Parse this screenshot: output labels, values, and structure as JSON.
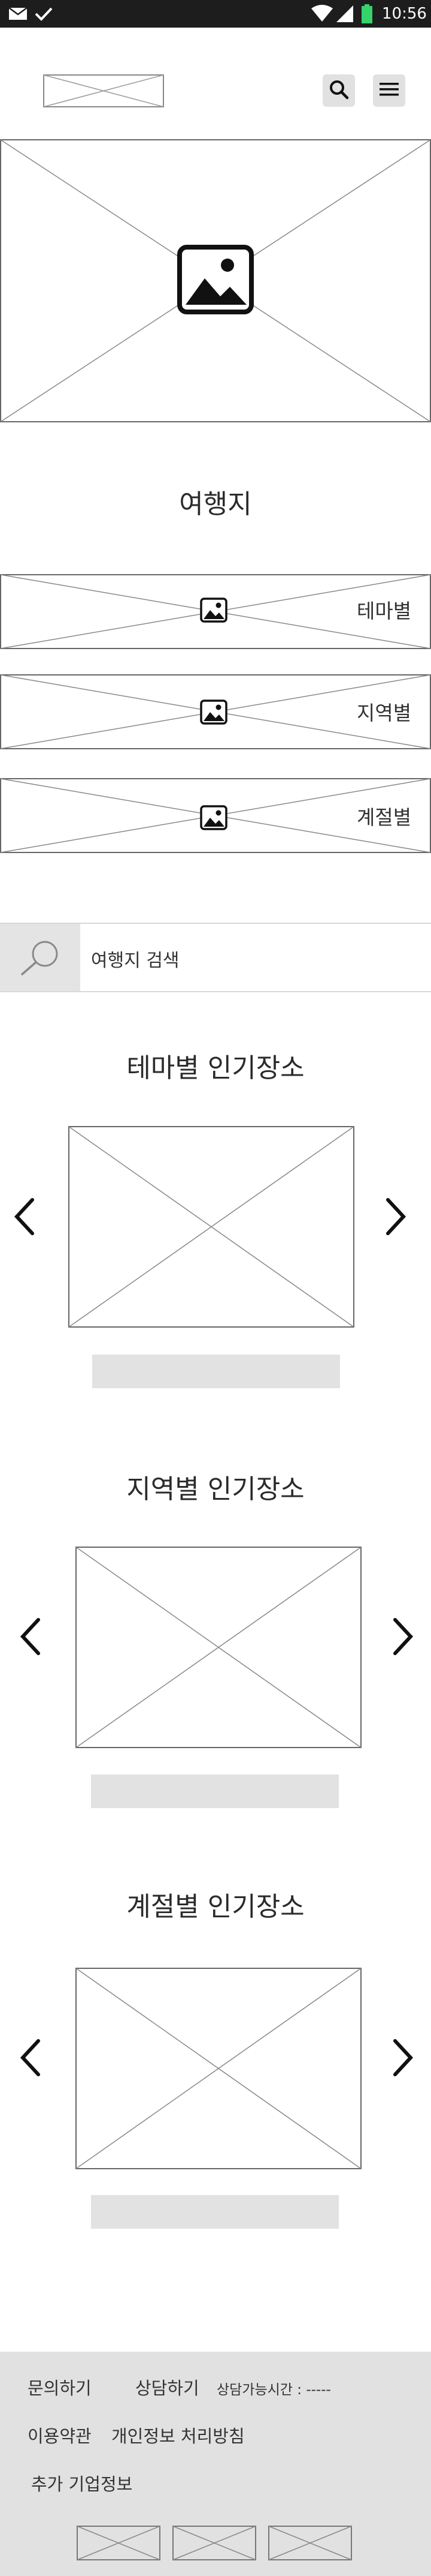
{
  "status_bar": {
    "time": "10:56",
    "left_icons": [
      "mail-icon",
      "check-icon"
    ],
    "right_icons": [
      "wifi-icon",
      "signal-icon",
      "battery-icon"
    ],
    "battery_color": "#36d36a"
  },
  "header": {
    "logo_icon": "logo-placeholder",
    "search_icon": "search-icon",
    "menu_icon": "hamburger-menu-icon"
  },
  "sections": {
    "destinations_title": "여행지",
    "categories": [
      {
        "label": "테마별"
      },
      {
        "label": "지역별"
      },
      {
        "label": "계절별"
      }
    ],
    "search_placeholder": "여행지 검색",
    "carousels": [
      {
        "title": "테마별 인기장소"
      },
      {
        "title": "지역별 인기장소"
      },
      {
        "title": "계절별 인기장소"
      }
    ]
  },
  "footer": {
    "contact": "문의하기",
    "consult": "상담하기",
    "consult_hours": "상담가능시간 : -----",
    "terms": "이용약관",
    "privacy": "개인정보 처리방침",
    "company_info": "추가 기업정보"
  },
  "colors": {
    "status_bar_bg": "#1d1d1d",
    "placeholder_bg": "#e2e2e2",
    "footer_bg": "#e1e1e1"
  }
}
